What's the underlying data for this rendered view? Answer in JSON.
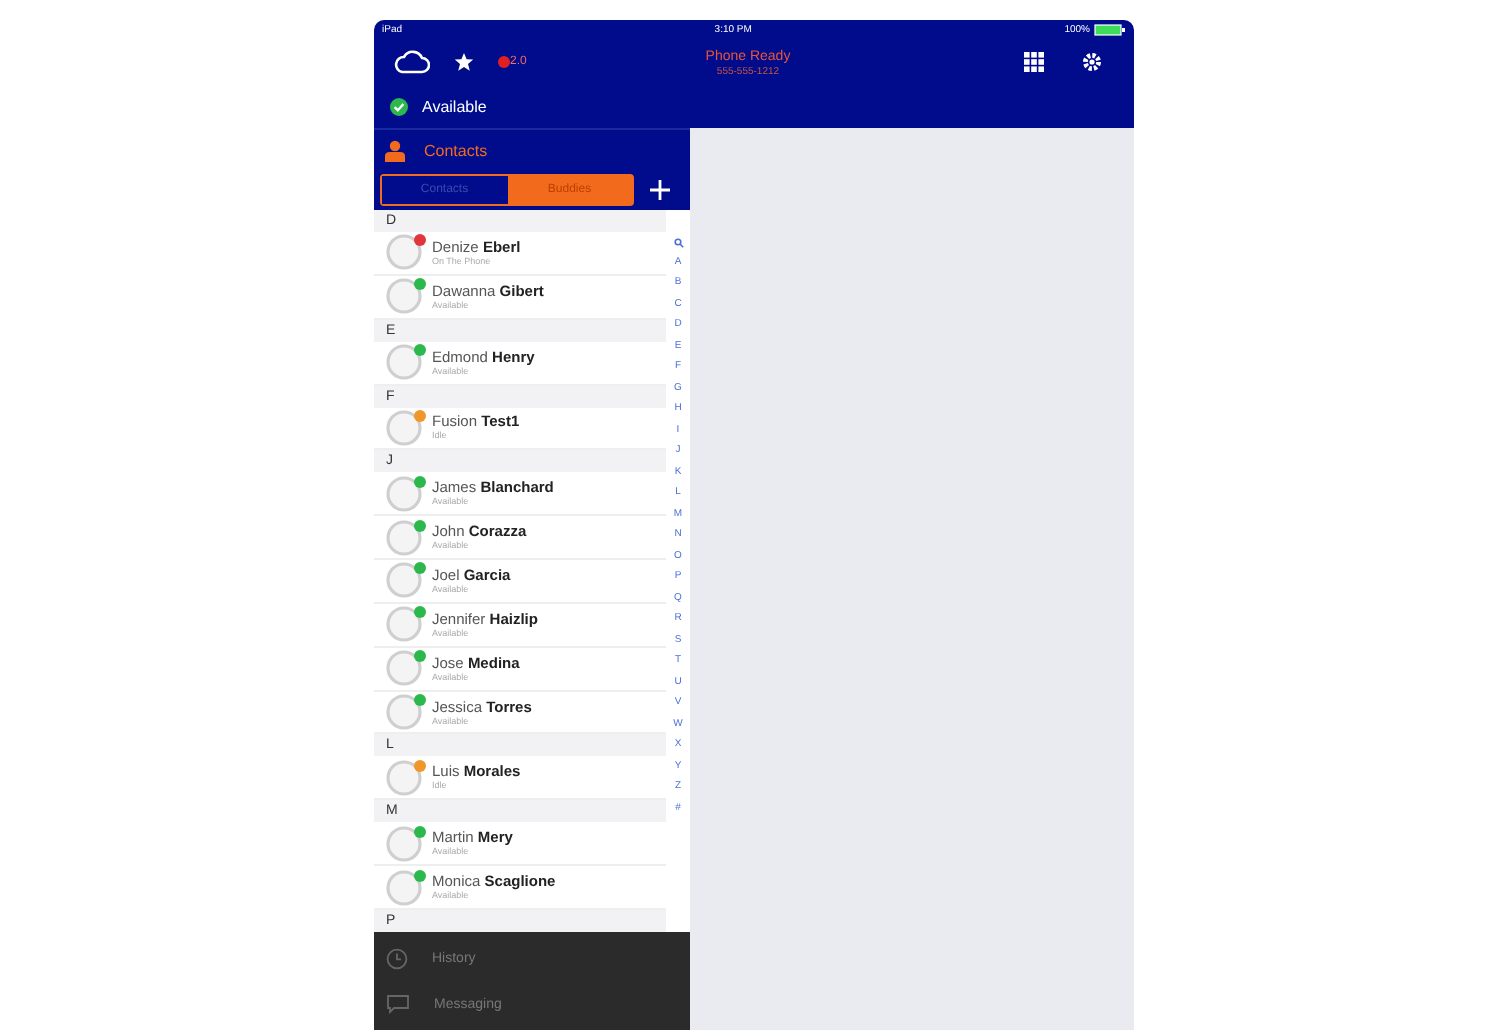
{
  "status_bar": {
    "device": "iPad",
    "time": "3:10 PM",
    "battery": "100%"
  },
  "header": {
    "badge": "2.0",
    "title": "Phone Ready",
    "subtitle": "555-555-1212"
  },
  "presence": {
    "label": "Available",
    "color": "#2db84d"
  },
  "section_title": "Contacts",
  "segments": [
    {
      "label": "Contacts",
      "selected": false
    },
    {
      "label": "Buddies",
      "selected": true
    }
  ],
  "sections": [
    {
      "letter": "D",
      "contacts": [
        {
          "first": "Denize",
          "last": "Eberl",
          "status": "On The Phone",
          "color": "#e0363c"
        },
        {
          "first": "Dawanna",
          "last": "Gibert",
          "status": "Available",
          "color": "#2db84d"
        }
      ]
    },
    {
      "letter": "E",
      "contacts": [
        {
          "first": "Edmond",
          "last": "Henry",
          "status": "Available",
          "color": "#2db84d"
        }
      ]
    },
    {
      "letter": "F",
      "contacts": [
        {
          "first": "Fusion",
          "last": "Test1",
          "status": "Idle",
          "color": "#f0962a"
        }
      ]
    },
    {
      "letter": "J",
      "contacts": [
        {
          "first": "James",
          "last": "Blanchard",
          "status": "Available",
          "color": "#2db84d"
        },
        {
          "first": "John",
          "last": "Corazza",
          "status": "Available",
          "color": "#2db84d"
        },
        {
          "first": "Joel",
          "last": "Garcia",
          "status": "Available",
          "color": "#2db84d"
        },
        {
          "first": "Jennifer",
          "last": "Haizlip",
          "status": "Available",
          "color": "#2db84d"
        },
        {
          "first": "Jose",
          "last": "Medina",
          "status": "Available",
          "color": "#2db84d"
        },
        {
          "first": "Jessica",
          "last": "Torres",
          "status": "Available",
          "color": "#2db84d"
        }
      ]
    },
    {
      "letter": "L",
      "contacts": [
        {
          "first": "Luis",
          "last": "Morales",
          "status": "Idle",
          "color": "#f0962a"
        }
      ]
    },
    {
      "letter": "M",
      "contacts": [
        {
          "first": "Martin",
          "last": "Mery",
          "status": "Available",
          "color": "#2db84d"
        },
        {
          "first": "Monica",
          "last": "Scaglione",
          "status": "Available",
          "color": "#2db84d"
        }
      ]
    },
    {
      "letter": "P"
    }
  ],
  "index": [
    "A",
    "B",
    "C",
    "D",
    "E",
    "F",
    "G",
    "H",
    "I",
    "J",
    "K",
    "L",
    "M",
    "N",
    "O",
    "P",
    "Q",
    "R",
    "S",
    "T",
    "U",
    "V",
    "W",
    "X",
    "Y",
    "Z",
    "#"
  ],
  "bottom_nav": [
    {
      "label": "History",
      "kind": "history"
    },
    {
      "label": "Messaging",
      "kind": "messaging"
    }
  ]
}
